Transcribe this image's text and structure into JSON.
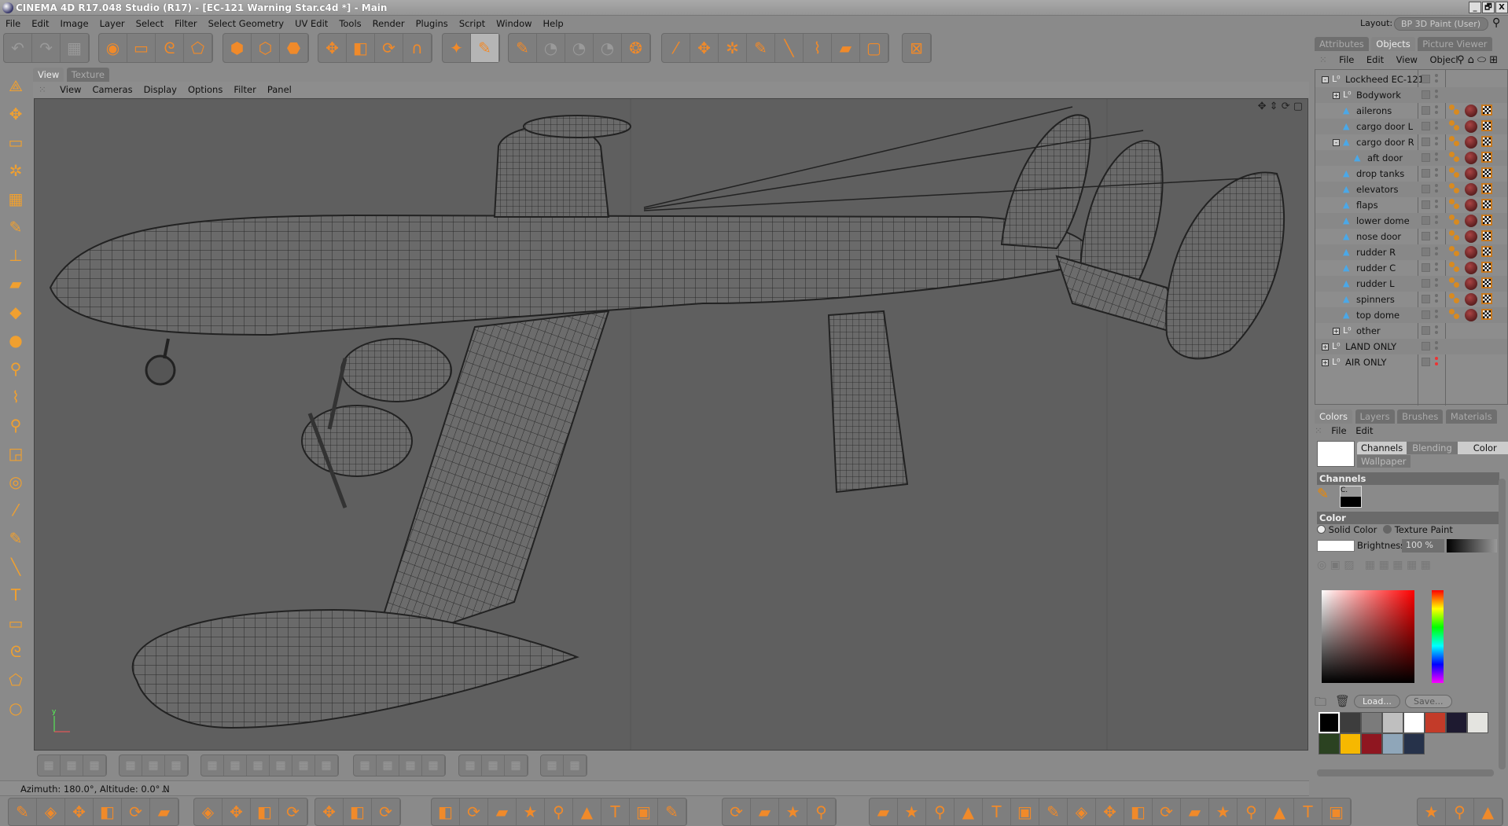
{
  "window": {
    "title": "CINEMA 4D R17.048 Studio (R17) - [EC-121 Warning Star.c4d *] - Main",
    "controls": [
      "_",
      "🗗",
      "X"
    ]
  },
  "menu": [
    "File",
    "Edit",
    "Image",
    "Layer",
    "Select",
    "Filter",
    "Select Geometry",
    "UV Edit",
    "Tools",
    "Render",
    "Plugins",
    "Script",
    "Window",
    "Help"
  ],
  "layout": {
    "label": "Layout:",
    "value": "BP 3D Paint  (User)"
  },
  "toolbar_groups": [
    [
      "undo-icon",
      "redo-icon",
      "checker-icon"
    ],
    [
      "live-select-icon",
      "rect-select-icon",
      "lasso-select-icon",
      "polygon-select-icon"
    ],
    [
      "points-mode-icon",
      "edges-mode-icon",
      "polygons-mode-icon"
    ],
    [
      "move-icon",
      "scale-icon",
      "rotate-icon",
      "magnet-icon"
    ],
    [
      "stars-brush-icon",
      "paint-3d-icon"
    ],
    [
      "paint-setup-icon",
      "bake-icon",
      "bake2-icon",
      "bake3-icon",
      "render-icon"
    ],
    [
      "eyedropper-icon",
      "clone-icon",
      "magic-wand-icon",
      "brush-icon",
      "line-icon",
      "smudge-icon",
      "eraser-icon",
      "frame-icon"
    ],
    [
      "fit-icon"
    ]
  ],
  "view_tabs": [
    "View",
    "Texture"
  ],
  "viewport_menu": [
    "View",
    "Cameras",
    "Display",
    "Options",
    "Filter",
    "Panel"
  ],
  "axis": {
    "y": "y",
    "x": "x"
  },
  "status": {
    "text": "Azimuth: 180.0°, Altitude: 0.0°  N",
    "extra": "..."
  },
  "panel_tabs": [
    "Attributes",
    "Objects",
    "Picture Viewer"
  ],
  "objects_menu": [
    "File",
    "Edit",
    "View",
    "Objecl"
  ],
  "objects": [
    {
      "name": "Lockheed EC-121",
      "type": "null",
      "level": 0,
      "expand": "-",
      "tags": false
    },
    {
      "name": "Bodywork",
      "type": "null",
      "level": 1,
      "expand": "+",
      "tags": false
    },
    {
      "name": "ailerons",
      "type": "poly",
      "level": 1,
      "tags": true
    },
    {
      "name": "cargo door L",
      "type": "poly",
      "level": 1,
      "tags": true
    },
    {
      "name": "cargo door R",
      "type": "poly",
      "level": 1,
      "expand": "-",
      "tags": true
    },
    {
      "name": "aft door",
      "type": "poly",
      "level": 2,
      "tags": true
    },
    {
      "name": "drop tanks",
      "type": "poly",
      "level": 1,
      "tags": true
    },
    {
      "name": "elevators",
      "type": "poly",
      "level": 1,
      "tags": true
    },
    {
      "name": "flaps",
      "type": "poly",
      "level": 1,
      "tags": true
    },
    {
      "name": "lower dome",
      "type": "poly",
      "level": 1,
      "tags": true
    },
    {
      "name": "nose door",
      "type": "poly",
      "level": 1,
      "tags": true
    },
    {
      "name": "rudder R",
      "type": "poly",
      "level": 1,
      "tags": true
    },
    {
      "name": "rudder C",
      "type": "poly",
      "level": 1,
      "tags": true
    },
    {
      "name": "rudder L",
      "type": "poly",
      "level": 1,
      "tags": true
    },
    {
      "name": "spinners",
      "type": "poly",
      "level": 1,
      "tags": true
    },
    {
      "name": "top dome",
      "type": "poly",
      "level": 1,
      "tags": true
    },
    {
      "name": "other",
      "type": "null",
      "level": 1,
      "expand": "+",
      "tags": false
    },
    {
      "name": "LAND ONLY",
      "type": "null",
      "level": 0,
      "expand": "+",
      "tags": false
    },
    {
      "name": "AIR ONLY",
      "type": "null",
      "level": 0,
      "expand": "+",
      "tags": false,
      "red": true
    }
  ],
  "colors_panel": {
    "tabs": [
      "Colors",
      "Layers",
      "Brushes",
      "Materials"
    ],
    "menu": [
      "File",
      "Edit"
    ],
    "mode_tabs": [
      "Channels",
      "Blending",
      "Color"
    ],
    "wallpaper": "Wallpaper",
    "channels_heading": "Channels",
    "channel_label": "C.",
    "color_heading": "Color",
    "solid_color": "Solid Color",
    "texture_paint": "Texture Paint",
    "brightness_label": "Brightness",
    "brightness_value": "100 %",
    "load": "Load...",
    "save": "Save...",
    "current_color": "#ffffff",
    "hue_color": "#ff0000",
    "swatches": [
      "#000000",
      "#3d3d3d",
      "#7b7b7b",
      "#bfbfbf",
      "#ffffff",
      "#c33b29",
      "#1e1a30",
      "#e4e4e0",
      "#2b4221",
      "#f6b800",
      "#8f1620",
      "#8fa6b9",
      "#26324a"
    ]
  }
}
